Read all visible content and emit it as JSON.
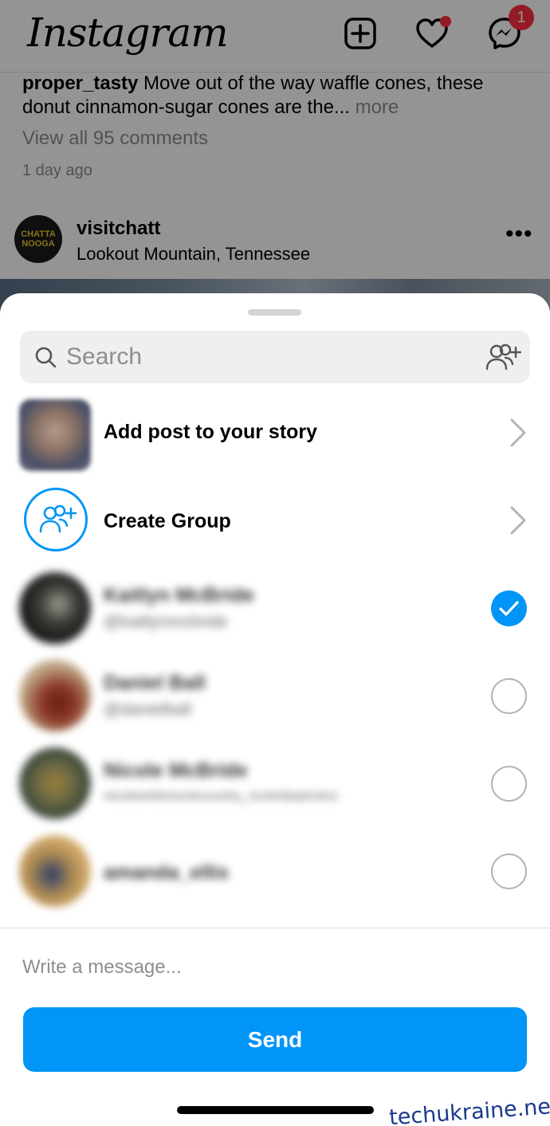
{
  "app": {
    "name": "Instagram",
    "messages_badge": "1"
  },
  "feed": {
    "caption_user": "proper_tasty",
    "caption_text": " Move out of the way waffle cones, these donut cinnamon-sugar cones are the...",
    "caption_more": " more",
    "view_comments": "View all 95 comments",
    "time_ago": "1 day ago",
    "post": {
      "username": "visitchatt",
      "location": "Lookout Mountain, Tennessee",
      "avatar_text": "CHATTA NOOGA"
    }
  },
  "share_sheet": {
    "search_placeholder": "Search",
    "add_to_story_label": "Add post to your story",
    "create_group_label": "Create Group",
    "contacts": [
      {
        "name": "Kaitlyn McBride",
        "handle": "@kaitlynmcbride",
        "selected": true
      },
      {
        "name": "Daniel Ball",
        "handle": "@danielball",
        "selected": false
      },
      {
        "name": "Nicole McBride",
        "handle": "nicolewhitmorelcountry_mcbridephotos",
        "selected": false
      },
      {
        "name": "amanda_ellis",
        "handle": "",
        "selected": false
      }
    ],
    "message_placeholder": "Write a message...",
    "send_label": "Send"
  },
  "watermark": "techukraine.net",
  "colors": {
    "accent": "#0095f6",
    "badge": "#ff3040"
  }
}
